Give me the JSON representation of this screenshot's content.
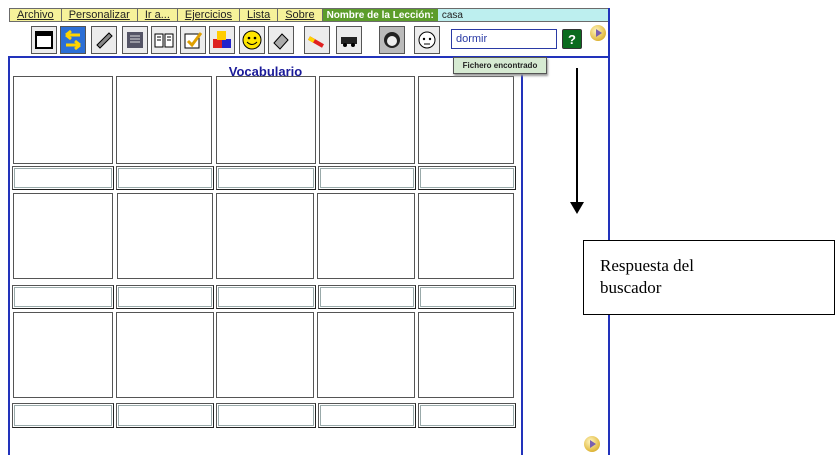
{
  "menu": {
    "items": [
      "Archivo",
      "Personalizar",
      "Ir a...",
      "Ejercicios",
      "Lista",
      "Sobre"
    ],
    "lesson_label": "Nombre de la Lección:",
    "lesson_value": "casa"
  },
  "toolbar": {
    "icons": [
      "window-icon",
      "swap-arrows-icon",
      "pencil-paper-icon",
      "notepad-icon",
      "open-book-icon",
      "checklist-icon",
      "blocks-icon",
      "smiley-icon",
      "eraser-hand-icon",
      "pencil-eraser-icon",
      "train-icon",
      "face-icon",
      "avatar-face-icon"
    ],
    "search_value": "dormir",
    "help_label": "?"
  },
  "tooltip": "Fichero encontrado",
  "vocabulary": {
    "title": "Vocabulario"
  },
  "annotation": {
    "line1": "Respuesta del",
    "line2": "buscador"
  }
}
